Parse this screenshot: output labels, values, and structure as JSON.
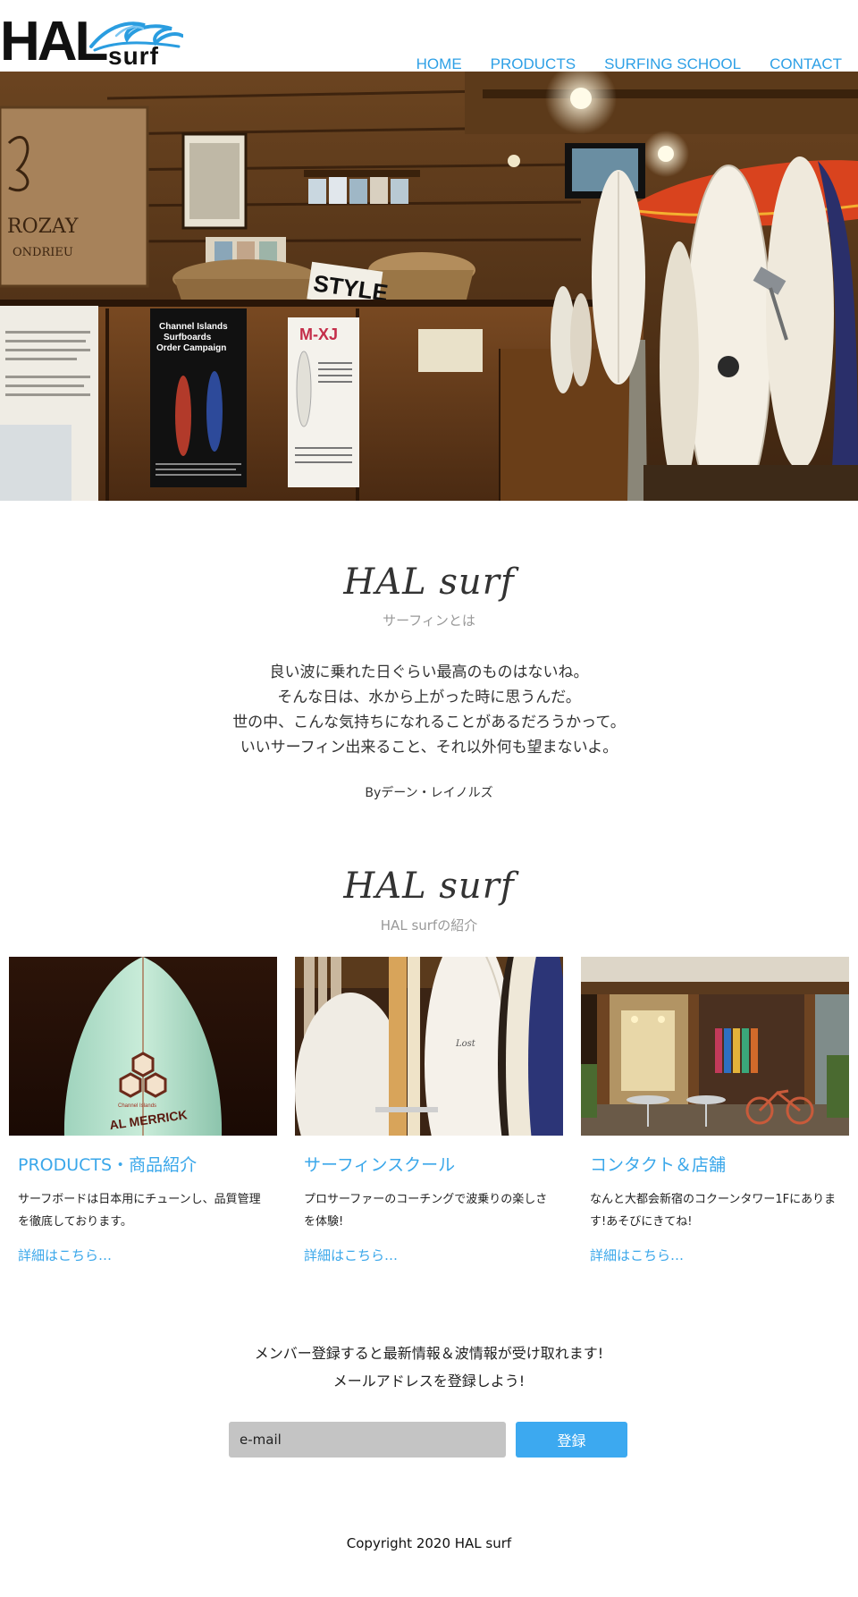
{
  "header": {
    "logo": {
      "main": "HAL",
      "sub": "surf"
    },
    "nav": [
      "HOME",
      "PRODUCTS",
      "SURFING SCHOOL",
      "CONTACT"
    ]
  },
  "hero": {
    "icon": "surf-shop-interior-photo",
    "visible_signage": [
      "Channel Islands Surfboards Order Campaign",
      "M-XJ",
      "STYLE",
      "ROZAY"
    ]
  },
  "intro": {
    "title": "HAL surf",
    "subtitle": "サーフィンとは",
    "quote_lines": [
      "良い波に乗れた日ぐらい最高のものはないね。",
      "そんな日は、水から上がった時に思うんだ。",
      "世の中、こんな気持ちになれることがあるだろうかって。",
      "いいサーフィン出来ること、それ以外何も望まないよ。"
    ],
    "author": "Byデーン・レイノルズ"
  },
  "features": {
    "title": "HAL surf",
    "subtitle": "HAL surfの紹介",
    "cards": [
      {
        "image": "surfboard-closeup-photo",
        "image_text": "AL MERRICK",
        "title": "PRODUCTS・商品紹介",
        "text": "サーフボードは日本用にチューンし、品質管理を徹底しております。",
        "link": "詳細はこちら…"
      },
      {
        "image": "surfboards-rack-photo",
        "title": "サーフィンスクール",
        "text": "プロサーファーのコーチングで波乗りの楽しさを体験!",
        "link": "詳細はこちら…"
      },
      {
        "image": "shop-storefront-photo",
        "title": "コンタクト＆店舗",
        "text": "なんと大都会新宿のコクーンタワー1Fにあります!あそびにきてね!",
        "link": "詳細はこちら…"
      }
    ]
  },
  "signup": {
    "lines": [
      "メンバー登録すると最新情報＆波情報が受け取れます!",
      "メールアドレスを登録しよう!"
    ],
    "placeholder": "e-mail",
    "button": "登録"
  },
  "footer": {
    "copyright": "Copyright 2020 HAL surf"
  },
  "colors": {
    "accent": "#3aa7ea",
    "button": "#3ca9f0",
    "input_bg": "#c4c4c4"
  }
}
